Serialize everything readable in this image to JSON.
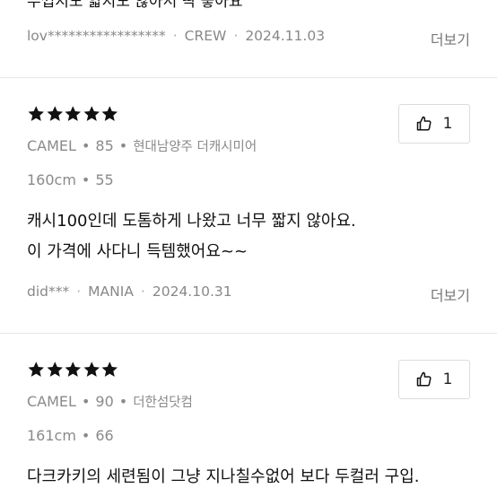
{
  "top_review": {
    "cutoff_text": "두껍지도 얇지도 않아서 딱 좋아요",
    "user": "lov*****************",
    "grade": "CREW",
    "date": "2024.11.03",
    "more_label": "더보기"
  },
  "reviews": [
    {
      "rating": 5,
      "like_count": "1",
      "grade": "CAMEL",
      "size": "85",
      "store": "현대남양주 더캐시미어",
      "height": "160cm",
      "weight": "55",
      "text_lines": [
        "캐시100인데 도톰하게 나왔고 너무 짧지 않아요.",
        "이 가격에 사다니 득템했어요~~"
      ],
      "user": "did***",
      "user_grade": "MANIA",
      "date": "2024.10.31",
      "more_label": "더보기"
    },
    {
      "rating": 5,
      "like_count": "1",
      "grade": "CAMEL",
      "size": "90",
      "store": "더한섬닷컴",
      "height": "161cm",
      "weight": "66",
      "text_lines": [
        "다크카키의 세련됨이 그냥 지나칠수없어 보다 두컬러 구입."
      ]
    }
  ],
  "separator": "•",
  "meta_separator": "·",
  "icons": {
    "star": "star-icon",
    "thumb": "thumbs-up-icon"
  },
  "colors": {
    "star": "#111111",
    "meta": "#888888"
  }
}
